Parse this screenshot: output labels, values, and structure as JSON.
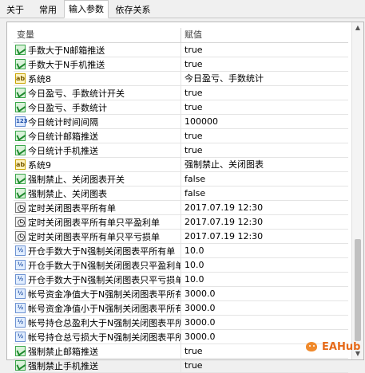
{
  "tabs": [
    {
      "label": "关于",
      "active": false
    },
    {
      "label": "常用",
      "active": false
    },
    {
      "label": "输入参数",
      "active": true
    },
    {
      "label": "依存关系",
      "active": false
    }
  ],
  "table": {
    "col_variable": "变量",
    "col_value": "赋值",
    "rows": [
      {
        "icon": "bool",
        "name": "手数大于N邮箱推送",
        "value": "true"
      },
      {
        "icon": "bool",
        "name": "手数大于N手机推送",
        "value": "true"
      },
      {
        "icon": "ab",
        "name": "系统8",
        "value": "今日盈亏、手数统计"
      },
      {
        "icon": "bool",
        "name": "今日盈亏、手数统计开关",
        "value": "true"
      },
      {
        "icon": "bool",
        "name": "今日盈亏、手数统计",
        "value": "true"
      },
      {
        "icon": "num",
        "name": "今日统计时间间隔",
        "value": "100000"
      },
      {
        "icon": "bool",
        "name": "今日统计邮箱推送",
        "value": "true"
      },
      {
        "icon": "bool",
        "name": "今日统计手机推送",
        "value": "true"
      },
      {
        "icon": "ab",
        "name": "系统9",
        "value": "强制禁止、关闭图表"
      },
      {
        "icon": "bool",
        "name": "强制禁止、关闭图表开关",
        "value": "false"
      },
      {
        "icon": "bool",
        "name": "强制禁止、关闭图表",
        "value": "false"
      },
      {
        "icon": "datetime",
        "name": "定时关闭图表平所有单",
        "value": "2017.07.19 12:30"
      },
      {
        "icon": "datetime",
        "name": "定时关闭图表平所有单只平盈利单",
        "value": "2017.07.19 12:30"
      },
      {
        "icon": "datetime",
        "name": "定时关闭图表平所有单只平亏损单",
        "value": "2017.07.19 12:30"
      },
      {
        "icon": "half",
        "name": "开仓手数大于N强制关闭图表平所有单",
        "value": "10.0"
      },
      {
        "icon": "half",
        "name": "开仓手数大于N强制关闭图表只平盈利单",
        "value": "10.0"
      },
      {
        "icon": "half",
        "name": "开仓手数大于N强制关闭图表只平亏损单",
        "value": "10.0"
      },
      {
        "icon": "half",
        "name": "帐号资金净值大于N强制关闭图表平所有单",
        "value": "3000.0"
      },
      {
        "icon": "half",
        "name": "帐号资金净值小于N强制关闭图表平所有单",
        "value": "3000.0"
      },
      {
        "icon": "half",
        "name": "帐号持仓总盈利大于N强制关闭图表平所?...",
        "value": "3000.0"
      },
      {
        "icon": "half",
        "name": "帐号持仓总亏损大于N强制关闭图表平所?...",
        "value": "3000.0"
      },
      {
        "icon": "bool",
        "name": "强制禁止邮箱推送",
        "value": "true"
      },
      {
        "icon": "bool",
        "name": "强制禁止手机推送",
        "value": "true"
      }
    ]
  },
  "icons": {
    "bool": "bool-check-icon",
    "ab": "string-ab-icon",
    "num": "integer-icon",
    "datetime": "datetime-clock-icon",
    "half": "double-icon"
  },
  "watermark": {
    "text": "EAHub"
  },
  "colors": {
    "accent": "#3aa64a",
    "watermark": "#e66a1a"
  }
}
